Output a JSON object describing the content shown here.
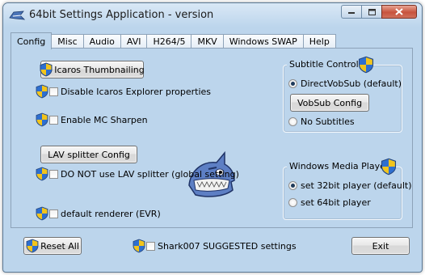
{
  "window": {
    "title": "64bit Settings Application - version",
    "icon": "app-logo-icon",
    "controls": [
      "minimize-icon",
      "maximize-icon",
      "close-icon"
    ]
  },
  "tabs": [
    {
      "label": "Config",
      "active": true
    },
    {
      "label": "Misc"
    },
    {
      "label": "Audio"
    },
    {
      "label": "AVI"
    },
    {
      "label": "H264/5"
    },
    {
      "label": "MKV"
    },
    {
      "label": "Windows SWAP"
    },
    {
      "label": "Help"
    }
  ],
  "config": {
    "icaros_button": "Icaros Thumbnailing",
    "disable_icaros": "Disable Icaros Explorer properties",
    "mc_sharpen": "Enable MC Sharpen",
    "lav_button": "LAV splitter Config",
    "no_lav": "DO NOT use LAV splitter (global setting)",
    "default_renderer": "default renderer (EVR)"
  },
  "subtitle_control": {
    "title": "Subtitle Control",
    "directvobsub": "DirectVobSub (default)",
    "vobsub_button": "VobSub Config",
    "no_subtitles": "No Subtitles",
    "selected": "DirectVobSub (default)"
  },
  "wmp": {
    "title": "Windows Media Player",
    "player32": "set 32bit player (default)",
    "player64": "set 64bit player",
    "selected": "set 32bit player (default)"
  },
  "footer": {
    "reset_all": "Reset All",
    "suggested": "Shark007 SUGGESTED settings",
    "exit": "Exit"
  },
  "colors": {
    "window_bg": "#bcd5ec",
    "close_button": "#c7533d",
    "shield_blue": "#2e6fd0",
    "shield_yellow": "#f2c41b"
  }
}
